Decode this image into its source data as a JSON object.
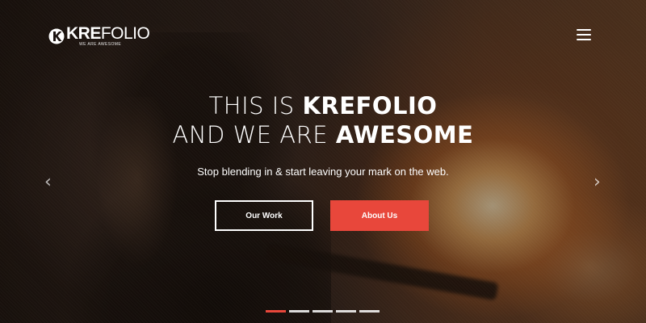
{
  "header": {
    "logo_bold": "KRE",
    "logo_light": "FOLIO",
    "logo_tagline": "WE ARE AWESOME"
  },
  "hero": {
    "line1_light": "THIS IS ",
    "line1_bold": "KREFOLIO",
    "line2_light": "AND WE ARE ",
    "line2_bold": "AWESOME",
    "subtitle": "Stop blending in & start leaving your mark on the web.",
    "primary_button": "Our Work",
    "secondary_button": "About Us"
  },
  "slider": {
    "prev_arrow": "‹",
    "next_arrow": "›",
    "slide_count": 5,
    "active_slide": 1
  },
  "colors": {
    "accent": "#e8473b",
    "text": "#ffffff"
  },
  "icons": {
    "logo": "krefolio-logo-icon",
    "menu": "hamburger-menu-icon",
    "prev": "chevron-left-icon",
    "next": "chevron-right-icon"
  }
}
